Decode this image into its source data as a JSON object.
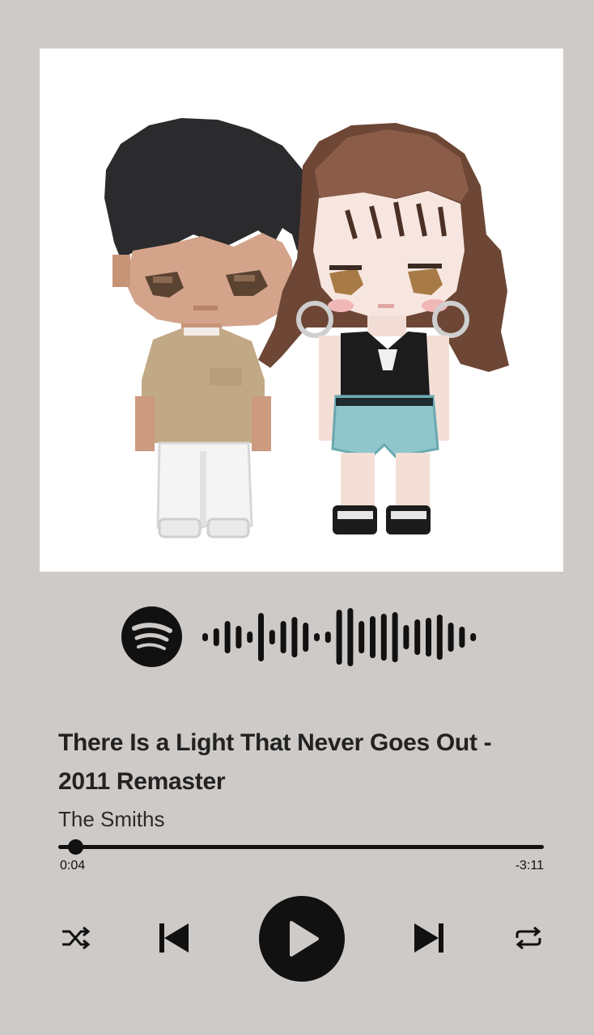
{
  "track": {
    "title_line1": "There Is a Light That Never Goes Out -",
    "title_line2": "2011 Remaster",
    "artist": "The Smiths"
  },
  "playback": {
    "elapsed": "0:04",
    "remaining": "-3:11",
    "progress_fraction": 0.035
  },
  "icons": {
    "logo": "spotify-icon",
    "code": "spotify-code-soundwave",
    "shuffle": "shuffle-icon",
    "previous": "skip-previous-icon",
    "play": "play-icon",
    "next": "skip-next-icon",
    "repeat": "repeat-icon"
  },
  "colors": {
    "background": "#cecac7",
    "foreground": "#111111",
    "artwork_background": "#ffffff"
  }
}
